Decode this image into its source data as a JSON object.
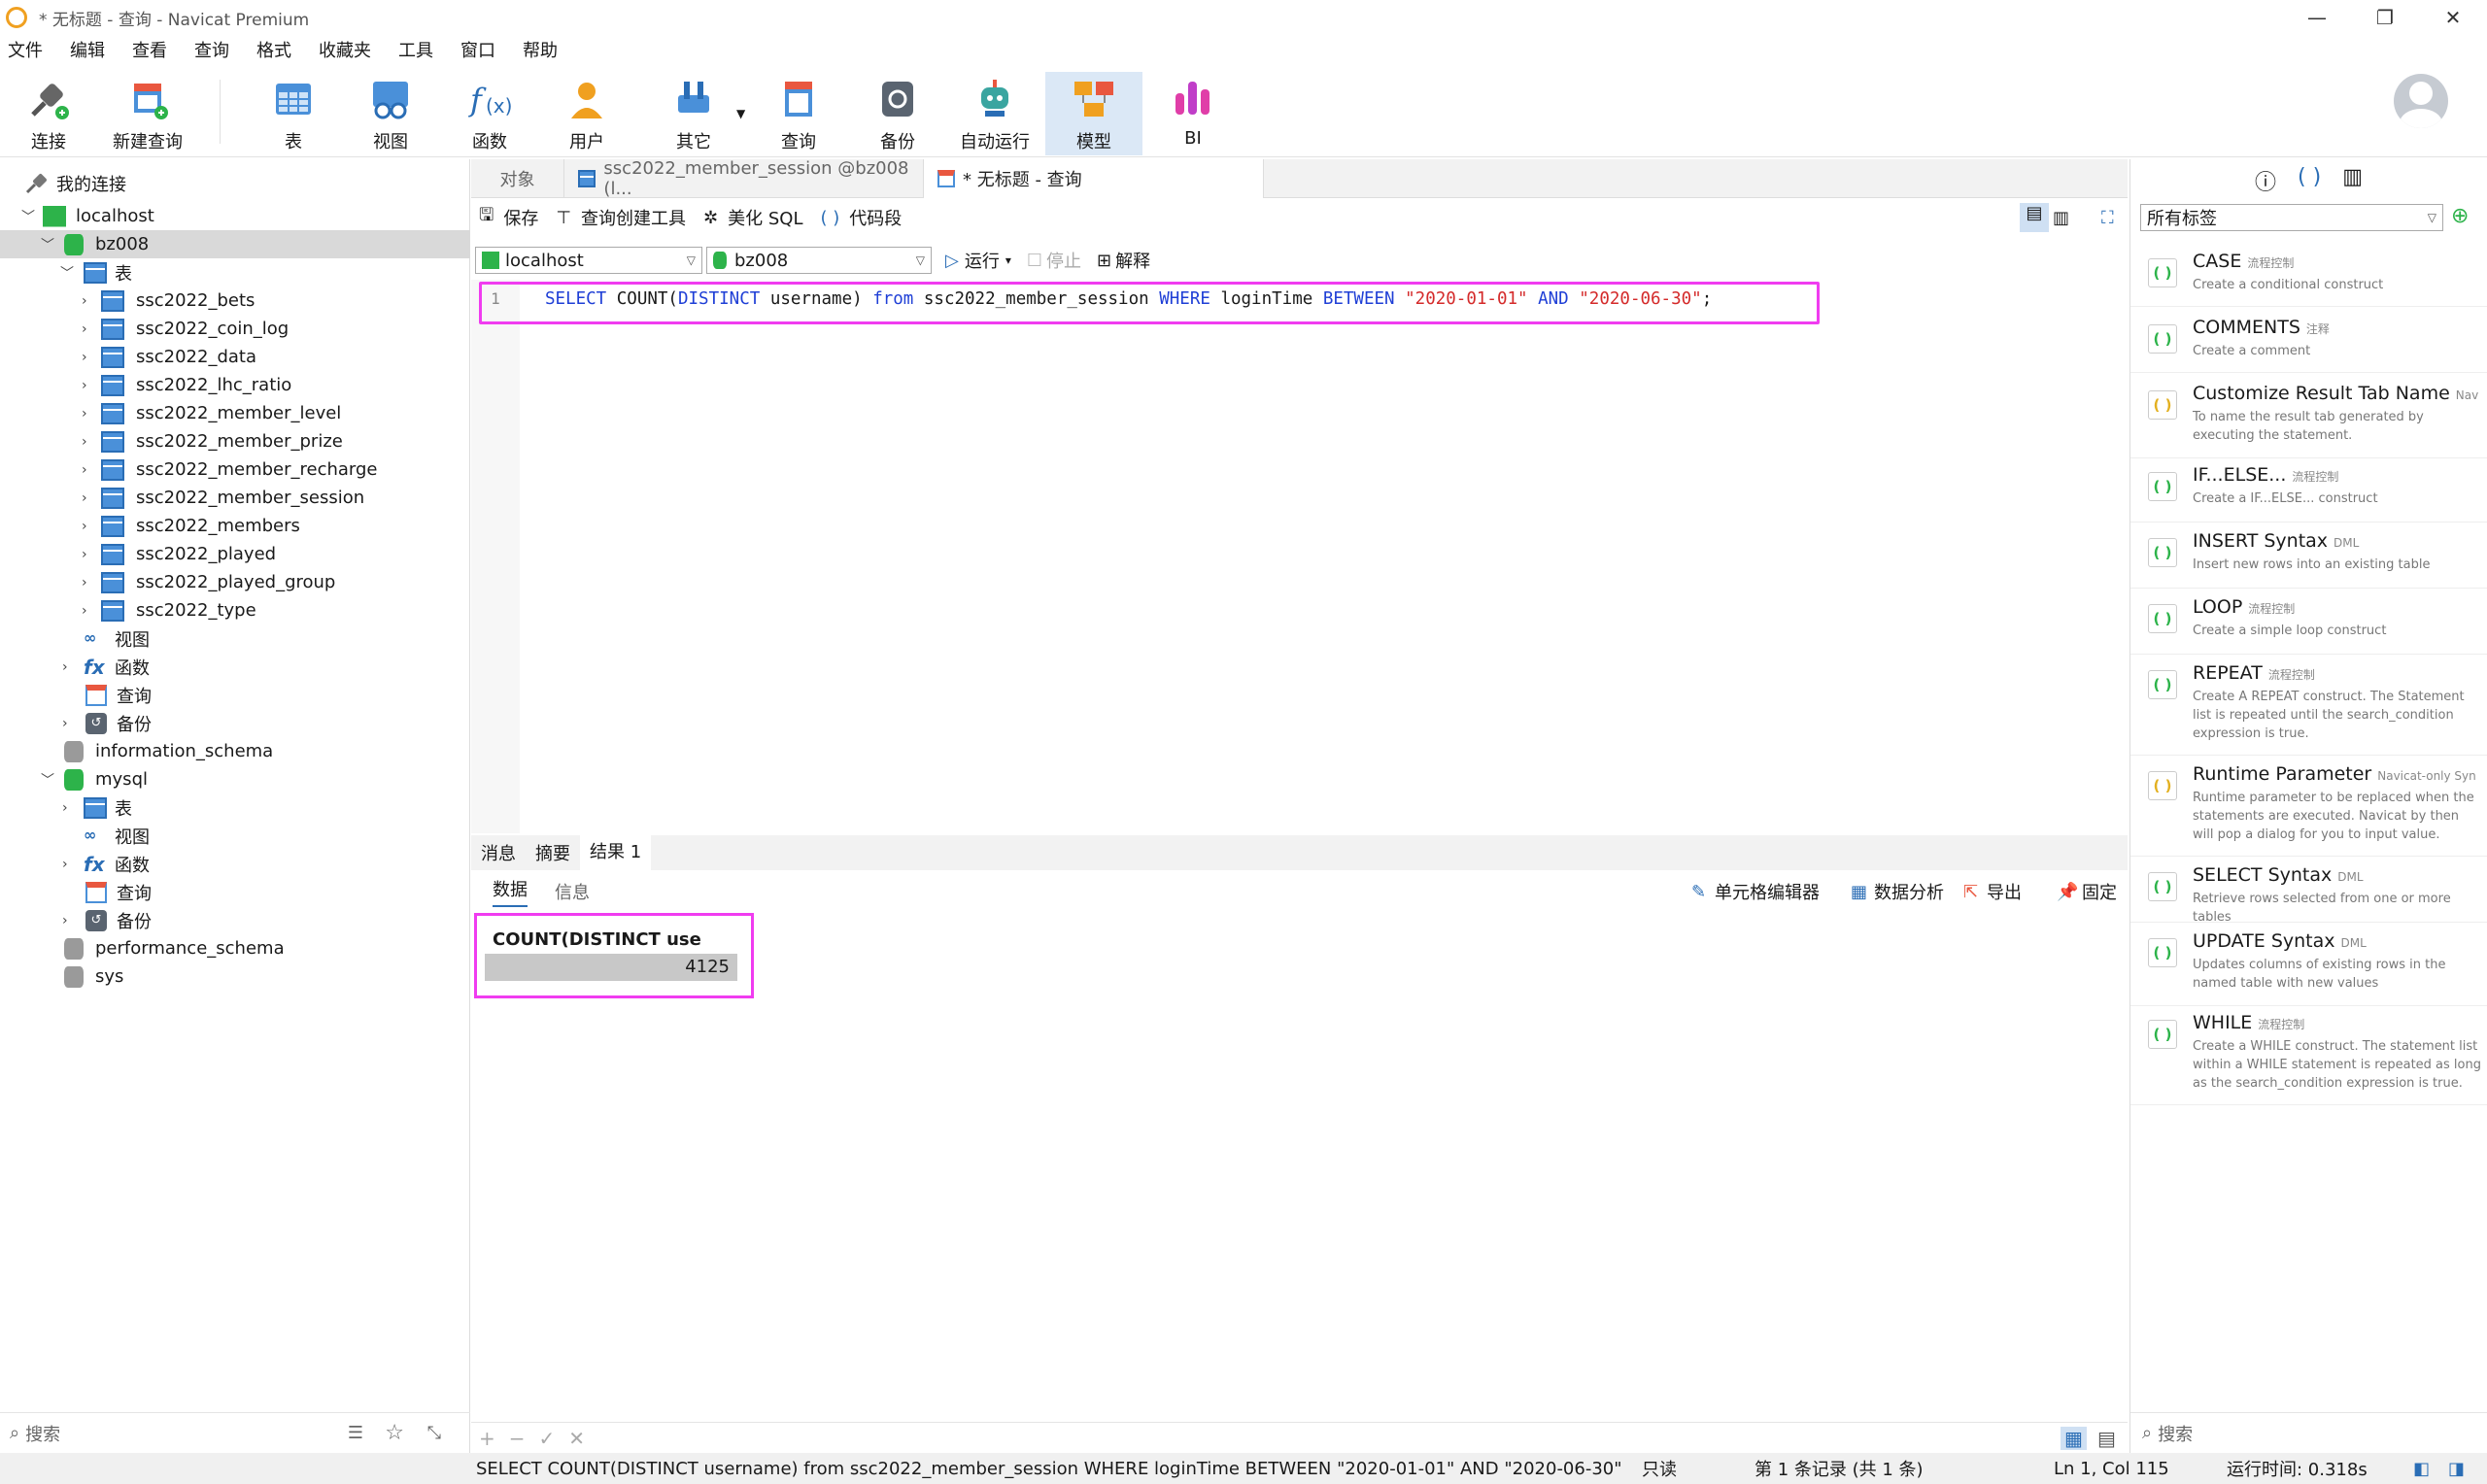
{
  "window": {
    "title": "* 无标题 - 查询 - Navicat Premium",
    "min": "—",
    "max": "❐",
    "close": "✕"
  },
  "menu": [
    "文件",
    "编辑",
    "查看",
    "查询",
    "格式",
    "收藏夹",
    "工具",
    "窗口",
    "帮助"
  ],
  "toolbar": [
    {
      "label": "连接",
      "icon": "connect-icon"
    },
    {
      "label": "新建查询",
      "icon": "new-query-icon"
    },
    {
      "label": "表",
      "icon": "table-icon"
    },
    {
      "label": "视图",
      "icon": "view-icon"
    },
    {
      "label": "函数",
      "icon": "function-icon"
    },
    {
      "label": "用户",
      "icon": "user-icon"
    },
    {
      "label": "其它",
      "icon": "tools-icon"
    },
    {
      "label": "查询",
      "icon": "query-icon"
    },
    {
      "label": "备份",
      "icon": "backup-icon"
    },
    {
      "label": "自动运行",
      "icon": "robot-icon"
    },
    {
      "label": "模型",
      "icon": "model-icon"
    },
    {
      "label": "BI",
      "icon": "bi-icon"
    }
  ],
  "tree": {
    "root": "我的连接",
    "host": "localhost",
    "db": "bz008",
    "tables_label": "表",
    "tables": [
      "ssc2022_bets",
      "ssc2022_coin_log",
      "ssc2022_data",
      "ssc2022_lhc_ratio",
      "ssc2022_member_level",
      "ssc2022_member_prize",
      "ssc2022_member_recharge",
      "ssc2022_member_session",
      "ssc2022_members",
      "ssc2022_played",
      "ssc2022_played_group",
      "ssc2022_type"
    ],
    "view": "视图",
    "func": "函数",
    "query": "查询",
    "backup": "备份",
    "other_dbs": [
      "information_schema"
    ],
    "mysql": "mysql",
    "mysql_children": [
      "表",
      "视图",
      "函数",
      "查询",
      "备份"
    ],
    "after": [
      "performance_schema",
      "sys"
    ]
  },
  "left_search": "搜索",
  "tabs": [
    "对象",
    "ssc2022_member_session @bz008 (l...",
    "* 无标题 - 查询"
  ],
  "qtool": {
    "save": "保存",
    "builder": "查询创建工具",
    "beautify": "美化 SQL",
    "snippet": "代码段"
  },
  "conn": {
    "host": "localhost",
    "db": "bz008",
    "run": "运行",
    "stop": "停止",
    "explain": "解释"
  },
  "sql": {
    "line": "1",
    "k1": "SELECT",
    "t1": " COUNT(",
    "k2": "DISTINCT",
    "t2": " username) ",
    "k3": "from",
    "t3": " ssc2022_member_session ",
    "k4": "WHERE",
    "t4": " loginTime ",
    "k5": "BETWEEN",
    "t5": " ",
    "s1": "\"2020-01-01\"",
    "t6": " ",
    "k6": "AND",
    "t7": " ",
    "s2": "\"2020-06-30\"",
    "t8": ";"
  },
  "result_tabs": [
    "消息",
    "摘要",
    "结果 1"
  ],
  "data_tabs": [
    "数据",
    "信息"
  ],
  "data_tools": [
    "单元格编辑器",
    "数据分析",
    "导出",
    "固定"
  ],
  "grid": {
    "header": "COUNT(DISTINCT use",
    "value": "4125"
  },
  "right": {
    "tags": "所有标签",
    "snippets": [
      {
        "name": "CASE",
        "tag": "流程控制",
        "desc": "Create a conditional construct"
      },
      {
        "name": "COMMENTS",
        "tag": "注释",
        "desc": "Create a comment"
      },
      {
        "name": "Customize Result Tab Name",
        "tag": "Nav",
        "desc": "To name the result tab generated by executing the statement."
      },
      {
        "name": "IF...ELSE...",
        "tag": "流程控制",
        "desc": "Create a IF...ELSE... construct"
      },
      {
        "name": "INSERT Syntax",
        "tag": "DML",
        "desc": "Insert new rows into an existing table"
      },
      {
        "name": "LOOP",
        "tag": "流程控制",
        "desc": "Create a simple loop construct"
      },
      {
        "name": "REPEAT",
        "tag": "流程控制",
        "desc": "Create A REPEAT construct. The Statement list is repeated until the search_condition expression is true."
      },
      {
        "name": "Runtime Parameter",
        "tag": "Navicat-only Syn",
        "desc": "Runtime parameter to be replaced when the statements are executed. Navicat by then will pop a dialog for you to input value."
      },
      {
        "name": "SELECT Syntax",
        "tag": "DML",
        "desc": "Retrieve rows selected from one or more tables"
      },
      {
        "name": "UPDATE Syntax",
        "tag": "DML",
        "desc": "Updates columns of existing rows in the named table with new values"
      },
      {
        "name": "WHILE",
        "tag": "流程控制",
        "desc": "Create a WHILE construct. The statement list within a WHILE statement is repeated as long as the search_condition expression is true."
      }
    ],
    "search": "搜索"
  },
  "status": {
    "sql": "SELECT COUNT(DISTINCT username) from ssc2022_member_session WHERE loginTime BETWEEN \"2020-01-01\" AND \"2020-06-30\"",
    "mode": "只读",
    "record": "第 1 条记录 (共 1 条)",
    "pos": "Ln 1, Col 115",
    "time": "运行时间: 0.318s"
  },
  "colors": {
    "highlight": "#f03cf0",
    "accent": "#1f3fd6",
    "string": "#d42a2a"
  }
}
